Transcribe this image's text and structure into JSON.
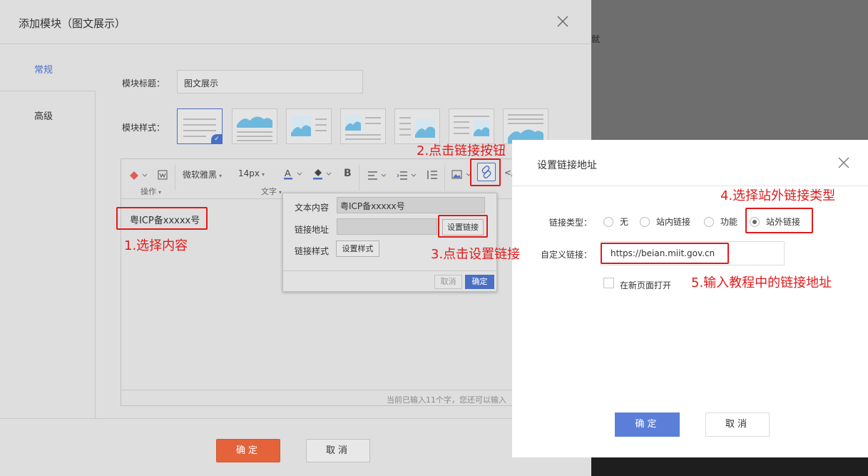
{
  "backdrop_text": "就",
  "main_dialog": {
    "title": "添加模块（图文展示）",
    "nav": {
      "general": "常规",
      "advanced": "高级"
    },
    "title_label": "模块标题：",
    "title_value": "图文展示",
    "style_label": "模块样式：",
    "toolbar": {
      "font": "微软雅黑",
      "size": "14px",
      "bold": "B",
      "code": "</",
      "group_ops": "操作",
      "group_text": "文字"
    },
    "content": "粤ICP备xxxxx号",
    "status": "当前已输入11个字，您还可以输入",
    "ok": "确定",
    "cancel": "取消"
  },
  "link_popup": {
    "text_label": "文本内容",
    "text_value": "粤ICP备xxxxx号",
    "url_label": "链接地址",
    "set_link": "设置链接",
    "style_label": "链接样式",
    "set_style": "设置样式",
    "cancel": "取消",
    "ok": "确定"
  },
  "link_dialog": {
    "title": "设置链接地址",
    "type_label": "链接类型：",
    "options": [
      "无",
      "站内链接",
      "功能",
      "站外链接"
    ],
    "selected_option": "站外链接",
    "custom_label": "自定义链接：",
    "url_value": "https://beian.miit.gov.cn",
    "new_window": "在新页面打开",
    "ok": "确定",
    "cancel": "取消"
  },
  "annotations": {
    "step1": "1.选择内容",
    "step2": "2.点击链接按钮",
    "step3": "3.点击设置链接",
    "step4": "4.选择站外链接类型",
    "step5": "5.输入教程中的链接地址"
  },
  "colors": {
    "accent": "#4a6fc4",
    "primary_orange": "#e4633a",
    "annotation_red": "#e01a1a"
  }
}
